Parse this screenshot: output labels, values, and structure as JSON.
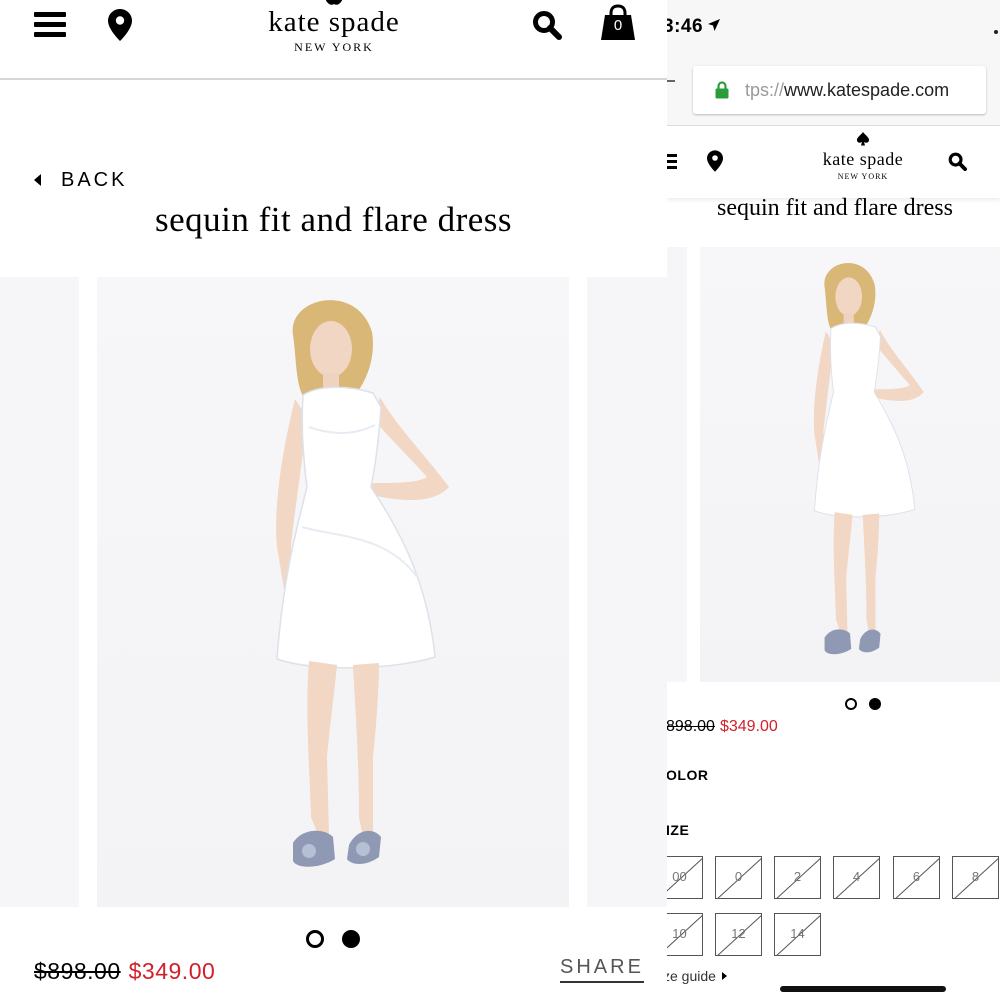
{
  "left": {
    "logo": {
      "brand": "kate spade",
      "city": "NEW YORK"
    },
    "cart_count": "0",
    "back_label": "BACK",
    "product_title": "sequin fit and flare dress",
    "price_original": "$898.00",
    "price_sale": "$349.00",
    "share_label": "SHARE",
    "carousel": {
      "total": 2,
      "active": 2
    }
  },
  "right": {
    "status_time": "3:46",
    "url_prefix": "tps://",
    "url_domain": "www.katespade.com",
    "logo": {
      "brand": "kate spade",
      "city": "NEW YORK"
    },
    "product_title": "sequin fit and flare dress",
    "price_original": "898.00",
    "price_sale": "$349.00",
    "color_label": "OLOR",
    "size_label": "IZE",
    "sizes_row1": [
      "00",
      "0",
      "2",
      "4",
      "6",
      "8"
    ],
    "sizes_row2": [
      "10",
      "12",
      "14"
    ],
    "size_guide": "ze guide",
    "carousel": {
      "total": 2,
      "active": 2
    }
  },
  "colors": {
    "sale_red": "#d0202b",
    "divider": "#d6d6d6",
    "lock_green": "#2a9d3a"
  },
  "icons": [
    "hamburger-icon",
    "location-pin-icon",
    "search-icon",
    "shopping-bag-icon",
    "spade-icon",
    "back-caret-icon",
    "lock-icon",
    "location-arrow-icon",
    "caret-right-icon"
  ]
}
